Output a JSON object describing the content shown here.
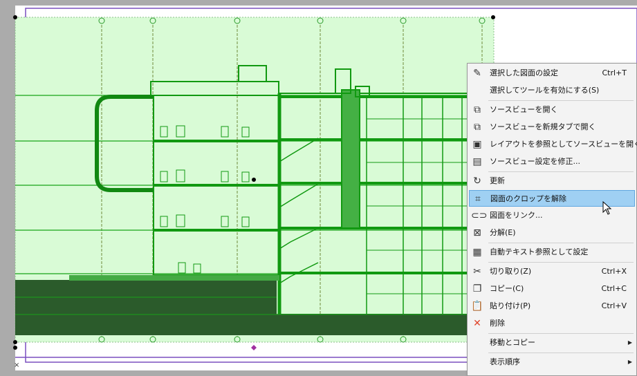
{
  "drawing": {
    "title": "building-section-view",
    "selection_color": "#d9fbd6",
    "line_color": "#17a317",
    "ground_color": "#2b5b2b",
    "frame_color": "#7a4fbf"
  },
  "context_menu": {
    "items": [
      {
        "icon": "pencil-settings-icon",
        "glyph": "✎",
        "label": "選択した図面の設定",
        "shortcut": "Ctrl+T"
      },
      {
        "icon": "",
        "glyph": "",
        "label": "選択してツールを有効にする(S)",
        "shortcut": ""
      },
      {
        "separator": true
      },
      {
        "icon": "open-source-view-icon",
        "glyph": "⧉",
        "label": "ソースビューを開く",
        "shortcut": ""
      },
      {
        "icon": "open-source-view-tab-icon",
        "glyph": "⧉",
        "label": "ソースビューを新規タブで開く",
        "shortcut": ""
      },
      {
        "icon": "layout-reference-icon",
        "glyph": "▣",
        "label": "レイアウトを参照としてソースビューを開く",
        "shortcut": ""
      },
      {
        "icon": "source-view-settings-icon",
        "glyph": "▤",
        "label": "ソースビュー設定を修正...",
        "shortcut": ""
      },
      {
        "separator": true
      },
      {
        "icon": "refresh-icon",
        "glyph": "↻",
        "label": "更新",
        "shortcut": ""
      },
      {
        "icon": "crop-icon",
        "glyph": "⌗",
        "label": "図面のクロップを解除",
        "shortcut": "",
        "highlighted": true
      },
      {
        "icon": "link-icon",
        "glyph": "⊂⊃",
        "label": "図面をリンク...",
        "shortcut": ""
      },
      {
        "icon": "explode-icon",
        "glyph": "⊠",
        "label": "分解(E)",
        "shortcut": ""
      },
      {
        "separator": true
      },
      {
        "icon": "autotext-icon",
        "glyph": "▦",
        "label": "自動テキスト参照として設定",
        "shortcut": ""
      },
      {
        "separator": true
      },
      {
        "icon": "scissors-icon",
        "glyph": "✂",
        "label": "切り取り(Z)",
        "shortcut": "Ctrl+X"
      },
      {
        "icon": "copy-icon",
        "glyph": "❐",
        "label": "コピー(C)",
        "shortcut": "Ctrl+C"
      },
      {
        "icon": "paste-icon",
        "glyph": "📋",
        "label": "貼り付け(P)",
        "shortcut": "Ctrl+V"
      },
      {
        "icon": "delete-x-icon",
        "glyph": "✕",
        "label": "削除",
        "shortcut": ""
      },
      {
        "separator": true
      },
      {
        "icon": "",
        "glyph": "",
        "label": "移動とコピー",
        "shortcut": "",
        "submenu": true
      },
      {
        "separator": true
      },
      {
        "icon": "",
        "glyph": "",
        "label": "表示順序",
        "shortcut": "",
        "submenu": true
      }
    ]
  }
}
